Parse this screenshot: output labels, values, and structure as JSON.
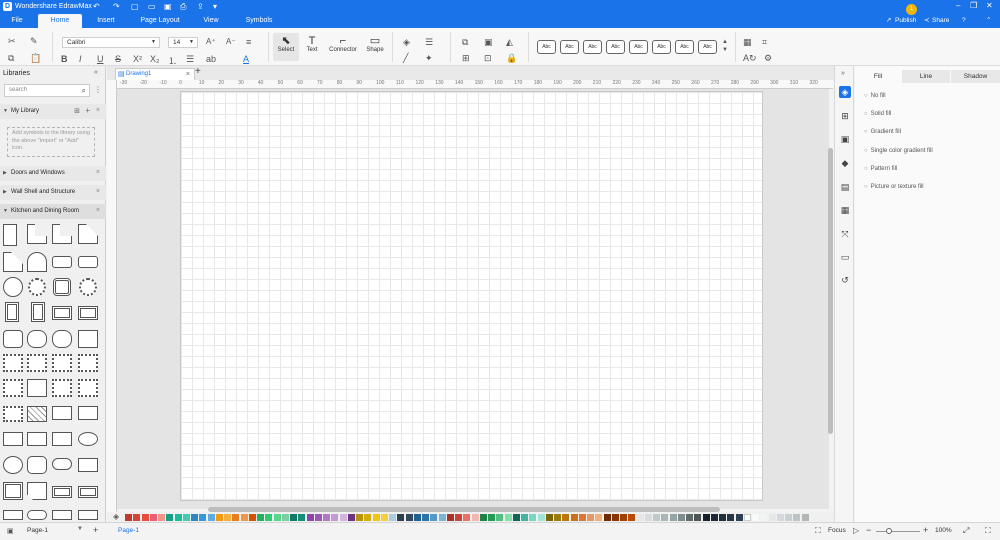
{
  "app": {
    "title": "Wondershare EdrawMax",
    "logo": "edraw-logo-icon"
  },
  "quick_access": [
    "undo-icon",
    "redo-icon",
    "new-icon",
    "open-icon",
    "save-icon",
    "print-icon",
    "export-icon",
    "more-icon"
  ],
  "window_controls": [
    "minimize-icon",
    "maximize-icon",
    "close-icon"
  ],
  "ribbon": {
    "tabs": [
      "File",
      "Home",
      "Insert",
      "Page Layout",
      "View",
      "Symbols"
    ],
    "active_tab": "Home",
    "right": {
      "user_initial": "1",
      "publish": "Publish",
      "share": "Share",
      "help": "?"
    }
  },
  "toolbar": {
    "font_name": "Calibri",
    "font_size": "14",
    "tools": [
      "Select",
      "Text",
      "Connector",
      "Shape"
    ],
    "styles": [
      "Abc",
      "Abc",
      "Abc",
      "Abc",
      "Abc",
      "Abc",
      "Abc",
      "Abc"
    ]
  },
  "libraries": {
    "title": "Libraries",
    "search_placeholder": "search",
    "my_library": "My Library",
    "empty_hint": "Add symbols to the library using the above \"Import\" or \"Add\" icon.",
    "categories": [
      "Doors and Windows",
      "Wall Shell and Structure",
      "Kitchen and Dining Room"
    ]
  },
  "document": {
    "tab_name": "Drawing1"
  },
  "ruler": {
    "h_ticks": [
      "-30",
      "-20",
      "-10",
      "0",
      "10",
      "20",
      "30",
      "40",
      "50",
      "60",
      "70",
      "80",
      "90",
      "100",
      "110",
      "120",
      "130",
      "140",
      "150",
      "160",
      "170",
      "180",
      "190",
      "200",
      "210",
      "220",
      "230",
      "240",
      "250",
      "260",
      "270",
      "280",
      "290",
      "300",
      "310",
      "320"
    ]
  },
  "palette_colors": [
    "#c0392b",
    "#d4453a",
    "#e74c3c",
    "#e95f74",
    "#f1948a",
    "#16a085",
    "#1abc9c",
    "#48c9b0",
    "#2e86c1",
    "#3498db",
    "#5dade2",
    "#f39c12",
    "#f5b041",
    "#e67e22",
    "#eb984e",
    "#d35400",
    "#27ae60",
    "#2ecc71",
    "#58d68d",
    "#7dcea0",
    "#117a65",
    "#148f77",
    "#8e44ad",
    "#9b59b6",
    "#af7ac5",
    "#c39bd3",
    "#d2b4de",
    "#6c3483",
    "#b7950b",
    "#d4ac0d",
    "#f1c40f",
    "#f4d03f",
    "#a9cce3",
    "#2c3e50",
    "#34495e",
    "#1f618d",
    "#2874a6",
    "#5499c7",
    "#7fb3d5",
    "#a93226",
    "#cb4335",
    "#ec7063",
    "#f5b7b1",
    "#1d8348",
    "#239b56",
    "#52be80",
    "#82e0aa",
    "#0e6655",
    "#45b39d",
    "#76d7c4",
    "#a3e4d7",
    "#7d6608",
    "#9a7d0a",
    "#b9770e",
    "#ca6f1e",
    "#dc7633",
    "#e59866",
    "#f0b27a",
    "#6e2c00",
    "#873600",
    "#a04000",
    "#ba4a00",
    "#e5e7e9",
    "#d7dbdd",
    "#bfc9ca",
    "#aab7b8",
    "#95a5a6",
    "#7f8c8d",
    "#616a6b",
    "#4d5656",
    "#17202a",
    "#1c2833",
    "#212f3d",
    "#283747",
    "#2e4053",
    "#ffffff",
    "#f8f9f9",
    "#f2f3f4",
    "#e5e8e8",
    "#d5d8dc",
    "#cacfd2",
    "#bdc3c7",
    "#b3b6b7"
  ],
  "right_sidebar": {
    "icons": [
      "fill-icon",
      "grid-icon",
      "image-icon",
      "layers-icon",
      "page-icon",
      "data-icon",
      "fit-icon",
      "presentation-icon",
      "history-icon"
    ],
    "tabs": [
      "Fill",
      "Line",
      "Shadow"
    ],
    "fill_options": [
      "No fill",
      "Solid fill",
      "Gradient fill",
      "Single color gradient fill",
      "Pattern fill",
      "Picture or texture fill"
    ]
  },
  "status": {
    "page_dropdown": "Page-1",
    "page_tab": "Page-1",
    "focus": "Focus",
    "zoom": "100%"
  }
}
